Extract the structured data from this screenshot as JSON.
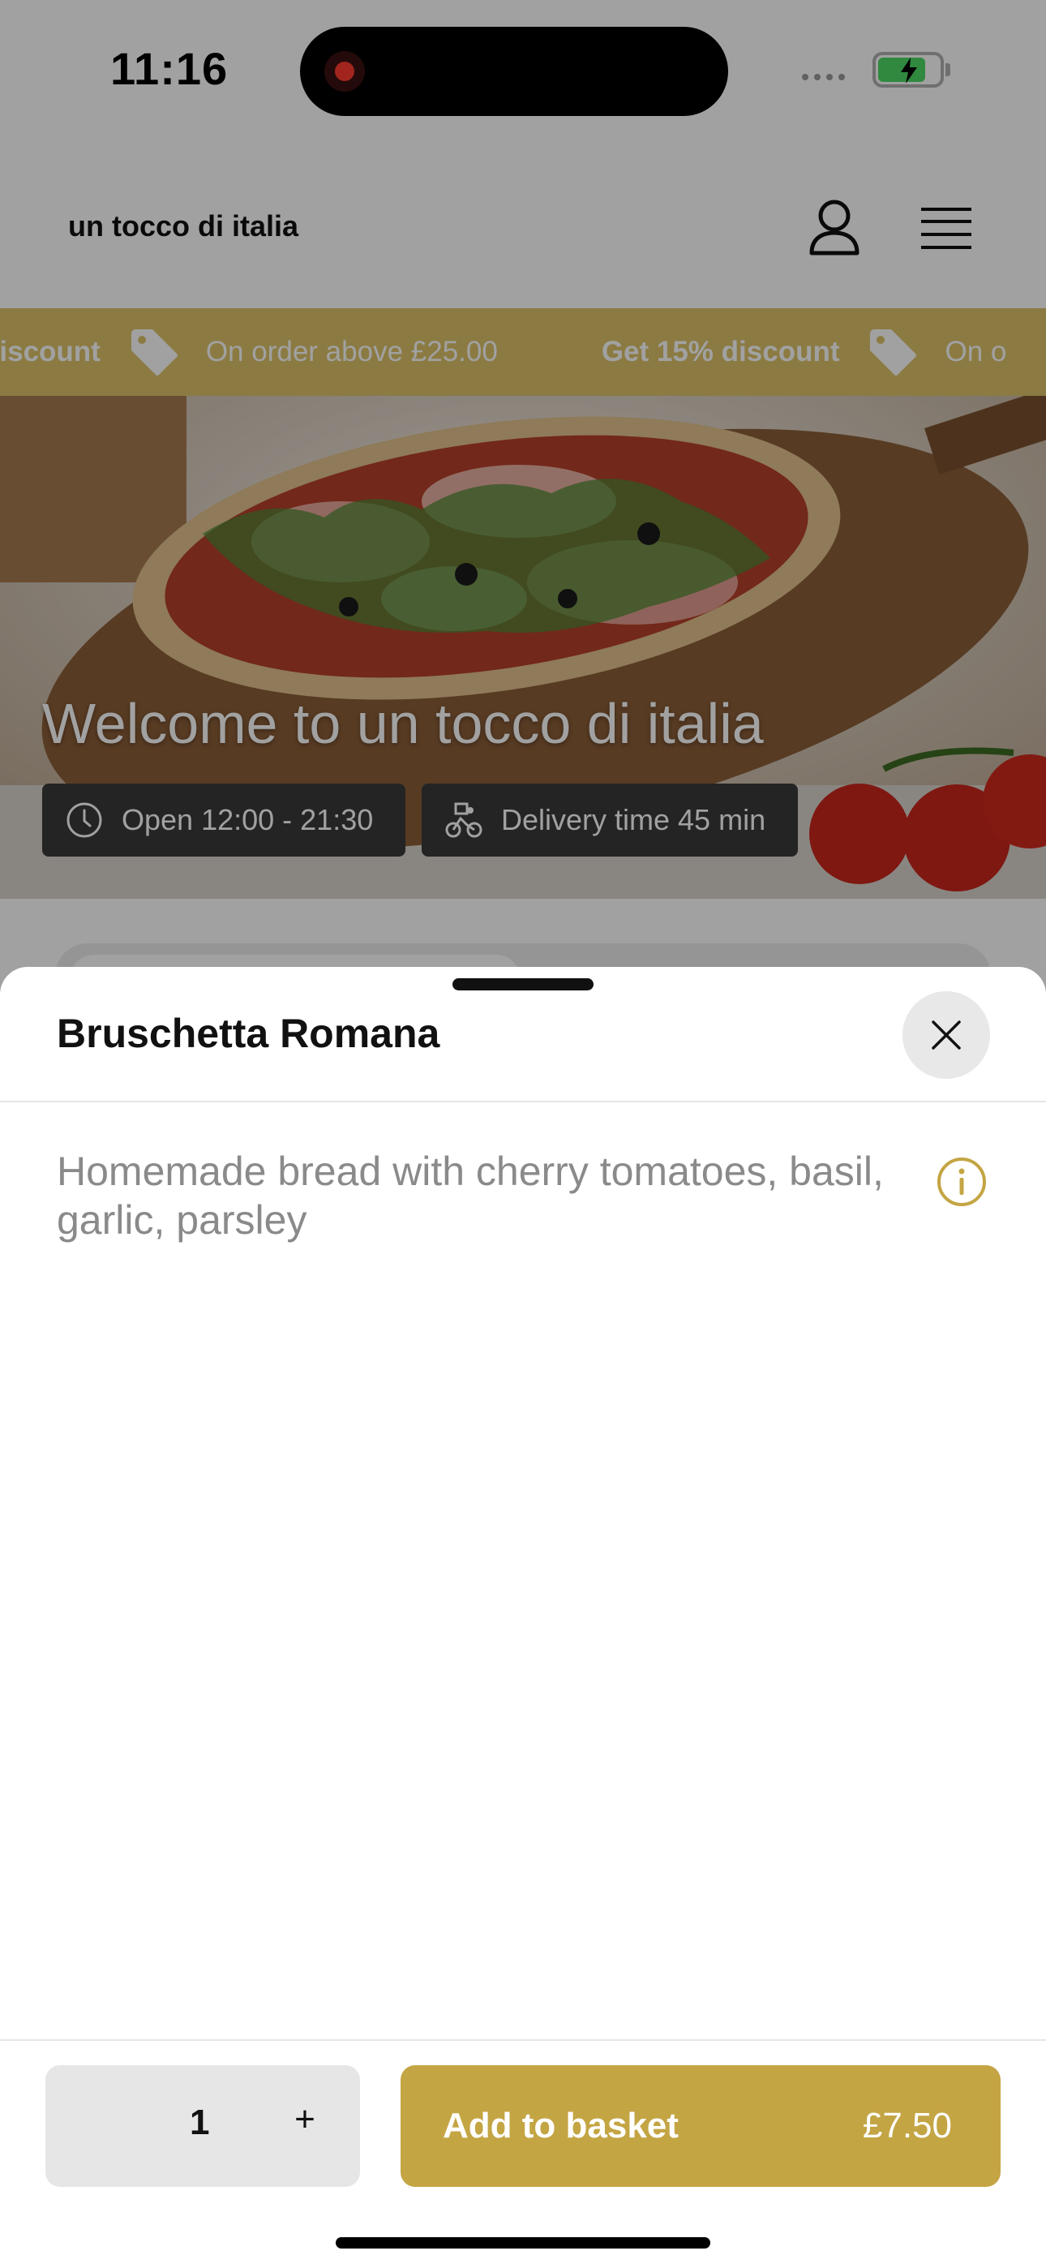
{
  "status_bar": {
    "time": "11:16"
  },
  "header": {
    "brand": "un tocco di italia"
  },
  "promo": {
    "items": [
      {
        "headline": "discount",
        "detail": "On order above £25.00"
      },
      {
        "headline": "Get 15% discount",
        "detail": "On o"
      }
    ]
  },
  "hero": {
    "title": "Welcome to un tocco di italia",
    "open_hours": "Open 12:00 - 21:30",
    "delivery": "Delivery time 45 min"
  },
  "sheet": {
    "title": "Bruschetta Romana",
    "description": "Homemade bread with cherry tomatoes, basil, garlic, parsley"
  },
  "bottom_bar": {
    "quantity": "1",
    "plus": "+",
    "add_label": "Add to basket",
    "price": "£7.50"
  },
  "colors": {
    "accent": "#c4a544",
    "promo_bg": "#dcc36a",
    "chip_bg": "#3a3a3a",
    "scrim": "rgba(0,0,0,0.37)"
  },
  "icons": [
    "record-icon",
    "battery-icon",
    "user-icon",
    "menu-icon",
    "tag-icon",
    "clock-icon",
    "bike-icon",
    "close-icon",
    "info-icon"
  ]
}
